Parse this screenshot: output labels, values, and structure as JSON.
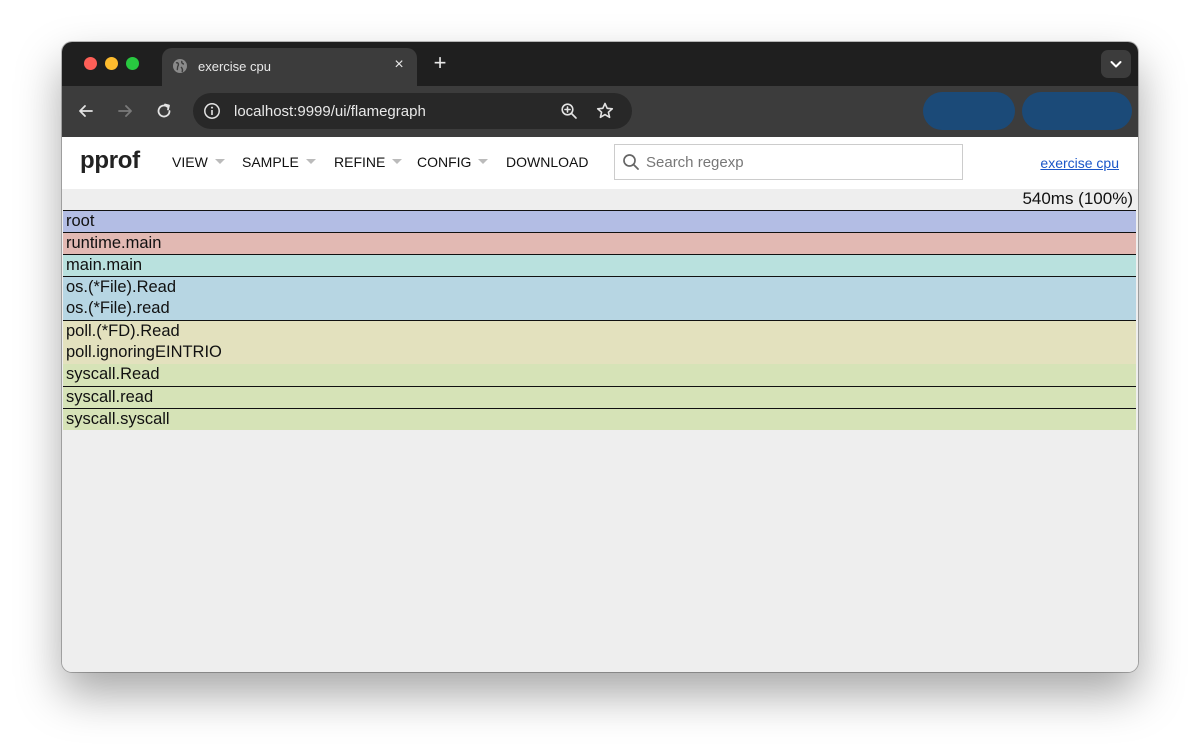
{
  "browser": {
    "tab_title": "exercise cpu",
    "tab_close": "×",
    "new_tab": "+",
    "url": "localhost:9999/ui/flamegraph"
  },
  "app": {
    "logo": "pprof",
    "menus": [
      "VIEW",
      "SAMPLE",
      "REFINE",
      "CONFIG",
      "DOWNLOAD"
    ],
    "search_placeholder": "Search regexp",
    "profile_link": "exercise cpu",
    "total": "540ms (100%)"
  },
  "colors": {
    "frames": [
      "#b3bde4",
      "#e2b9b3",
      "#b9e1de",
      "#b7d6e3",
      "#e3e1be",
      "#d6e3b7"
    ]
  },
  "flamegraph": {
    "frames": [
      {
        "name": "root"
      },
      {
        "name": "runtime.main"
      },
      {
        "name": "main.main"
      },
      {
        "name": "os.(*File).Read"
      },
      {
        "name": "os.(*File).read"
      },
      {
        "name": "poll.(*FD).Read"
      },
      {
        "name": "poll.ignoringEINTRIO"
      },
      {
        "name": "syscall.Read"
      },
      {
        "name": "syscall.read"
      },
      {
        "name": "syscall.syscall"
      }
    ]
  }
}
